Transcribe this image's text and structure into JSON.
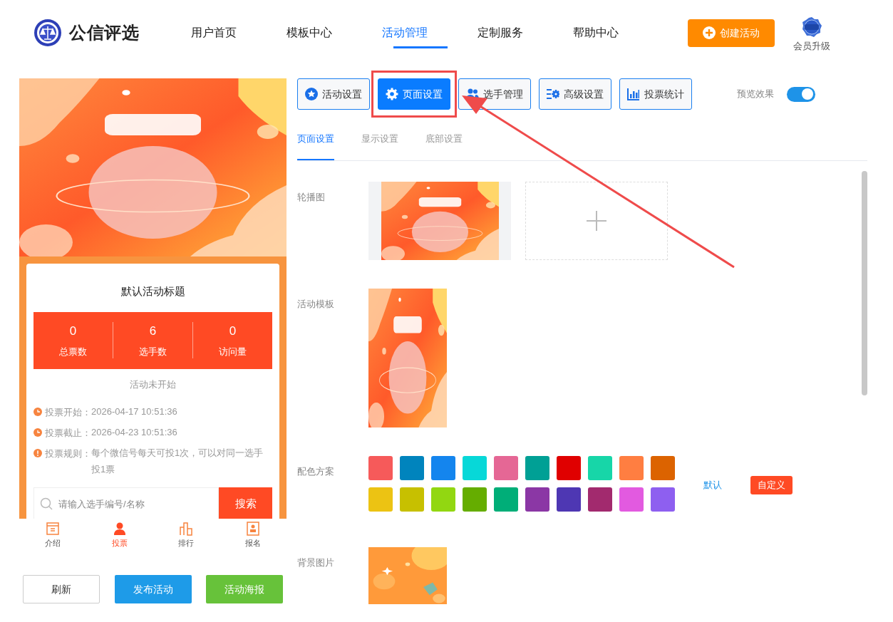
{
  "header": {
    "logo_text": "公信评选",
    "nav": [
      {
        "label": "用户首页",
        "selected": false
      },
      {
        "label": "模板中心",
        "selected": false
      },
      {
        "label": "活动管理",
        "selected": true
      },
      {
        "label": "定制服务",
        "selected": false
      },
      {
        "label": "帮助中心",
        "selected": false
      }
    ],
    "create_button": "创建活动",
    "vip_label": "会员升级"
  },
  "preview": {
    "title": "默认活动标题",
    "stats": [
      {
        "value": "0",
        "label": "总票数"
      },
      {
        "value": "6",
        "label": "选手数"
      },
      {
        "value": "0",
        "label": "访问量"
      }
    ],
    "status": "活动未开始",
    "info": [
      {
        "kind": "clock",
        "label": "投票开始：",
        "value": "2026-04-17 10:51:36"
      },
      {
        "kind": "clock",
        "label": "投票截止：",
        "value": "2026-04-23 10:51:36"
      },
      {
        "kind": "alert",
        "label": "投票规则：",
        "value": "每个微信号每天可投1次，可以对同一选手投1票"
      }
    ],
    "search": {
      "placeholder": "请输入选手编号/名称",
      "button": "搜索"
    },
    "bottom_nav": [
      {
        "kind": "doc",
        "label": "介绍",
        "selected": false
      },
      {
        "kind": "person",
        "label": "投票",
        "selected": true
      },
      {
        "kind": "chart",
        "label": "排行",
        "selected": false
      },
      {
        "kind": "badge",
        "label": "报名",
        "selected": false
      }
    ],
    "actions": [
      {
        "kind": "outline",
        "label": "刷新"
      },
      {
        "kind": "blue",
        "label": "发布活动"
      },
      {
        "kind": "green",
        "label": "活动海报"
      }
    ]
  },
  "toolbar": {
    "buttons": [
      {
        "kind": "star",
        "label": "活动设置",
        "selected": false
      },
      {
        "kind": "gear",
        "label": "页面设置",
        "selected": true
      },
      {
        "kind": "users",
        "label": "选手管理",
        "selected": false
      },
      {
        "kind": "sliders",
        "label": "高级设置",
        "selected": false
      },
      {
        "kind": "bars",
        "label": "投票统计",
        "selected": false
      }
    ],
    "preview_toggle": {
      "label": "预览效果",
      "on": true
    }
  },
  "subtabs": [
    {
      "label": "页面设置",
      "selected": true
    },
    {
      "label": "显示设置",
      "selected": false
    },
    {
      "label": "底部设置",
      "selected": false
    }
  ],
  "settings": {
    "carousel_label": "轮播图",
    "template_label": "活动模板",
    "colors": {
      "label": "配色方案",
      "swatches": [
        {
          "color": "#f65a5a"
        },
        {
          "color": "#0084bd"
        },
        {
          "color": "#1485ee"
        },
        {
          "color": "#07d8d8"
        },
        {
          "color": "#e56795"
        },
        {
          "color": "#00a095"
        },
        {
          "color": "#e00000"
        },
        {
          "color": "#17d6a8"
        },
        {
          "color": "#ff7e41"
        },
        {
          "color": "#dc6300"
        },
        {
          "color": "#ecc313"
        },
        {
          "color": "#c7c000"
        },
        {
          "color": "#92d711"
        },
        {
          "color": "#65ad00"
        },
        {
          "color": "#00ae78"
        },
        {
          "color": "#8b37a5"
        },
        {
          "color": "#4e37b3"
        },
        {
          "color": "#a22a6e"
        },
        {
          "color": "#e25ae0"
        },
        {
          "color": "#8e5ff0"
        }
      ],
      "default_link": "默认",
      "custom_button": "自定义"
    },
    "background_label": "背景图片"
  }
}
